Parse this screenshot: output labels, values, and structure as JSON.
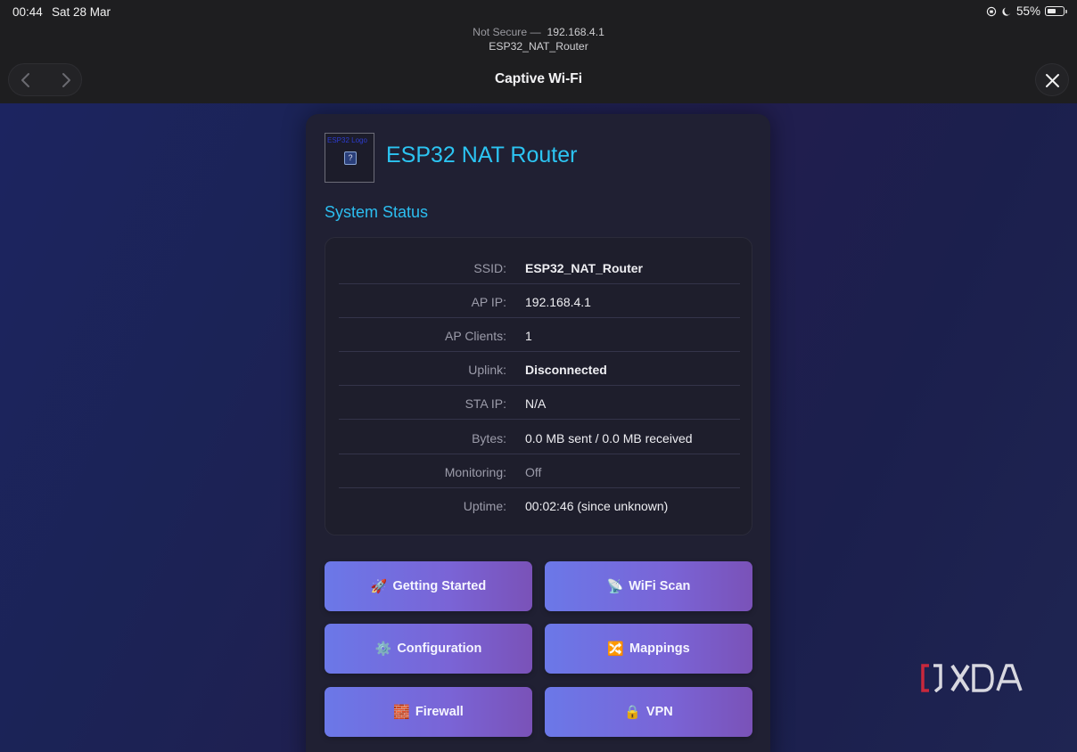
{
  "status_bar": {
    "time": "00:44",
    "date": "Sat 28 Mar",
    "battery": "55%"
  },
  "address": {
    "security": "Not Secure —",
    "host": "192.168.4.1",
    "network": "ESP32_NAT_Router"
  },
  "toolbar": {
    "title": "Captive Wi-Fi",
    "back_icon": "chevron-left-icon",
    "forward_icon": "chevron-right-icon",
    "close_icon": "close-icon"
  },
  "card": {
    "logo_alt": "ESP32 Logo",
    "heading": "ESP32 NAT Router",
    "section_title": "System Status"
  },
  "status": [
    {
      "label": "SSID:",
      "value": "ESP32_NAT_Router"
    },
    {
      "label": "AP IP:",
      "value": "192.168.4.1"
    },
    {
      "label": "AP Clients:",
      "value": "1"
    },
    {
      "label": "Uplink:",
      "value": "Disconnected"
    },
    {
      "label": "STA IP:",
      "value": "N/A"
    },
    {
      "label": "Bytes:",
      "value": "0.0 MB sent / 0.0 MB received"
    },
    {
      "label": "Monitoring:",
      "value": "Off"
    },
    {
      "label": "Uptime:",
      "value": "00:02:46 (since unknown)"
    }
  ],
  "buttons": [
    {
      "label": "Getting Started",
      "icon": "🚀",
      "icon_name": "rocket-icon"
    },
    {
      "label": "WiFi Scan",
      "icon": "📡",
      "icon_name": "satellite-dish-icon"
    },
    {
      "label": "Configuration",
      "icon": "⚙️",
      "icon_name": "gear-icon"
    },
    {
      "label": "Mappings",
      "icon": "🔀",
      "icon_name": "shuffle-icon"
    },
    {
      "label": "Firewall",
      "icon": "🧱",
      "icon_name": "firewall-icon"
    },
    {
      "label": "VPN",
      "icon": "🔒",
      "icon_name": "lock-icon"
    }
  ],
  "watermark": "XDA",
  "colors": {
    "accent": "#2cc4f2",
    "button_start": "#6b78e8",
    "button_end": "#7a52b8",
    "background": "#1c2460"
  }
}
